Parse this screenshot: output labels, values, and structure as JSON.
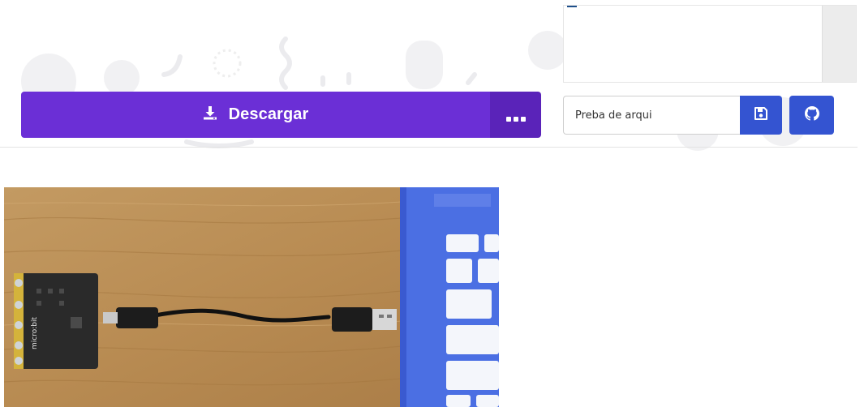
{
  "toolbar": {
    "download_label": "Descargar",
    "more_label": "...",
    "filename_value": "Preba de arqui",
    "filename_placeholder": "",
    "save_icon": "floppy-disk-icon",
    "github_icon": "github-icon",
    "download_icon": "download-icon"
  },
  "photo": {
    "subject": "micro-bit-connected-usb-cable-to-laptop",
    "board_label": "micro:bit"
  },
  "colors": {
    "download_bg": "#6b2fd6",
    "more_bg": "#5a23b9",
    "action_blue": "#3454d1",
    "wood": "#b98e55",
    "laptop_blue": "#4b6fe3"
  }
}
